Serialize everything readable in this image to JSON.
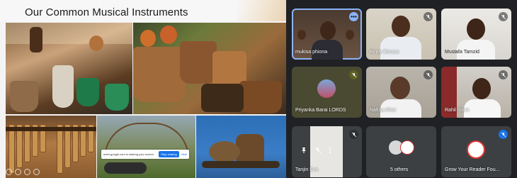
{
  "slide": {
    "title": "Our Common Musical Instruments",
    "share_banner": {
      "text": "meet.google.com is sharing your screen.",
      "stop_label": "Stop sharing",
      "hide_label": "Hide"
    }
  },
  "meet": {
    "participants": [
      {
        "name": "mukisa phiona",
        "mic": "muted-none",
        "active": true
      },
      {
        "name": "Binoy Biswas",
        "mic": "muted"
      },
      {
        "name": "Mustafa Tamzid",
        "mic": "muted"
      },
      {
        "name": "Priyanka Barai LORDS",
        "mic": "muted"
      },
      {
        "name": "Nafisa Akter",
        "mic": "muted"
      },
      {
        "name": "Rahil Islam",
        "mic": "muted"
      },
      {
        "name": "Tanjin Eva",
        "mic": "muted"
      },
      {
        "name": "5 others",
        "mic": "none"
      },
      {
        "name": "Grow Your Reader Fou...",
        "mic": "muted-blue"
      }
    ]
  },
  "colors": {
    "meet_bg": "#202124",
    "tile_bg": "#3c4043",
    "active_outline": "#8ab4f8",
    "mic_active": "#1a73e8"
  }
}
